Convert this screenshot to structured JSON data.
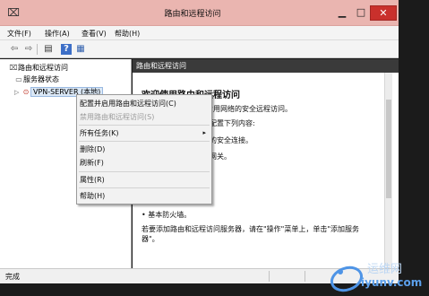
{
  "window": {
    "title": "路由和远程访问",
    "app_icon": "rras-icon",
    "minimize": "▁",
    "maximize": "□",
    "close": "✕"
  },
  "menubar": {
    "items": [
      "文件(F)",
      "操作(A)",
      "查看(V)",
      "帮助(H)"
    ]
  },
  "toolbar": {
    "buttons": [
      {
        "icon": "back-arrow-icon",
        "glyph": "⇦"
      },
      {
        "icon": "forward-arrow-icon",
        "glyph": "⇨"
      },
      {
        "icon": "console-tree-icon",
        "glyph": "▤"
      },
      {
        "icon": "help-icon",
        "glyph": "?"
      },
      {
        "icon": "properties-icon",
        "glyph": "▦"
      }
    ]
  },
  "tree": {
    "root": "路由和远程访问",
    "server_status": "服务器状态",
    "server_node": "VPN-SERVER (本地)"
  },
  "right_pane": {
    "header": "路由和远程访问",
    "welcome": "欢迎使用路由和远程访问",
    "lines": [
      "路由和远程访问提供专用网络的安全远程访问。",
      "配置下列内容:",
      "的安全连接。",
      "网关。",
      "• 基本防火墙。",
      "若要添加路由和远程访问服务器，请在\"操作\"菜单上，单击\"添加服务",
      "器\"。"
    ]
  },
  "context_menu": {
    "items": [
      {
        "label": "配置并启用路由和远程访问(C)",
        "disabled": false
      },
      {
        "label": "禁用路由和远程访问(S)",
        "disabled": true
      },
      {
        "label": "所有任务(K)",
        "disabled": false,
        "submenu": "▸"
      },
      {
        "label": "删除(D)",
        "disabled": false
      },
      {
        "label": "刷新(F)",
        "disabled": false
      },
      {
        "label": "属性(R)",
        "disabled": false
      },
      {
        "label": "帮助(H)",
        "disabled": false
      }
    ]
  },
  "statusbar": {
    "text": "完成"
  },
  "watermark": {
    "cn": "运维网",
    "en": "iyunv.com"
  },
  "colors": {
    "titlebar": "#eab5b0",
    "close_button": "#c9302c",
    "pane_header": "#3a3a3a",
    "selection": "#dbe8f6"
  }
}
